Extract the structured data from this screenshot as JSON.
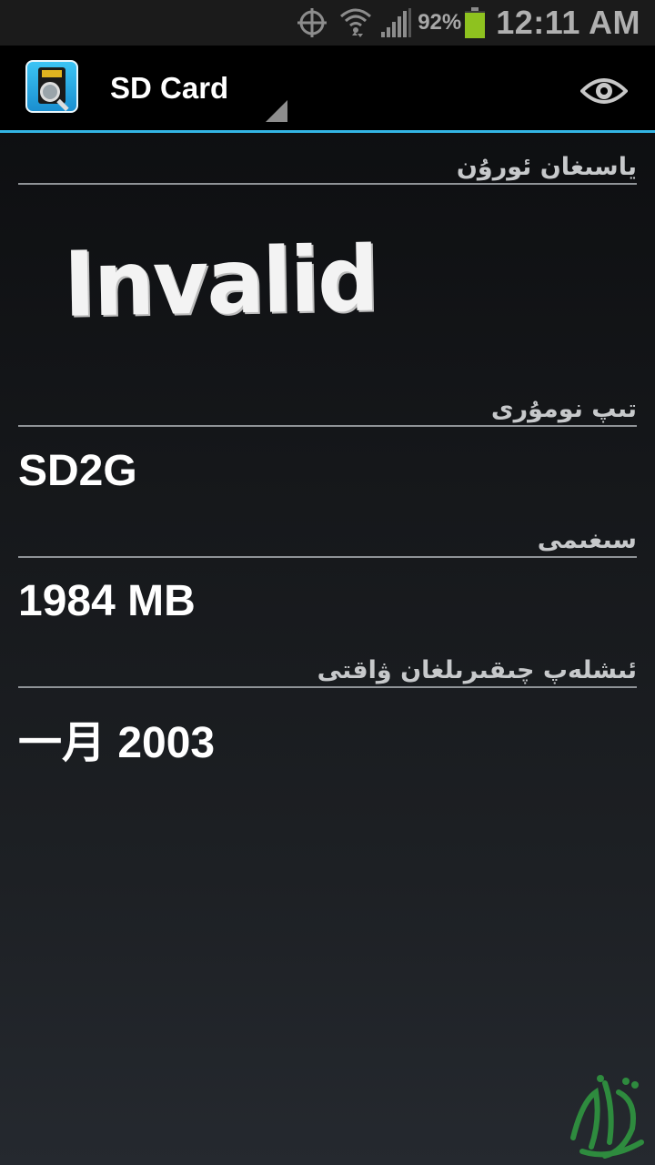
{
  "status_bar": {
    "battery_percent": "92%",
    "time": "12:11 AM",
    "icons": [
      "gps-icon",
      "wifi-icon",
      "signal-icon",
      "battery-icon"
    ]
  },
  "action_bar": {
    "spinner_label": "SD Card",
    "icons": [
      "app-icon",
      "eye-icon",
      "spinner-arrow"
    ]
  },
  "sections": [
    {
      "header": "ياسىغان ئورۇن",
      "value": "Invalid"
    },
    {
      "header": "تىپ نومۇرى",
      "value": "SD2G"
    },
    {
      "header": "سىغىمى",
      "value": "1984 MB"
    },
    {
      "header": "ئىشلەپ چىقىرىلغان ۋاقتى",
      "value": "一月 2003"
    }
  ],
  "colors": {
    "accent": "#33b5e5",
    "battery": "#8ec21f",
    "background_top": "#0b0c0e",
    "background_bottom": "#25292f"
  }
}
